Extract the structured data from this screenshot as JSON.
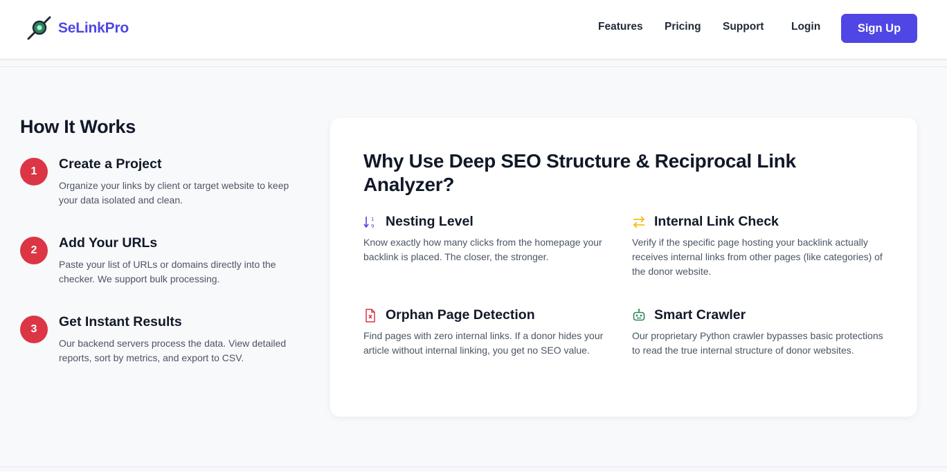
{
  "header": {
    "brand": "SeLinkPro",
    "nav": [
      {
        "label": "Features"
      },
      {
        "label": "Pricing"
      },
      {
        "label": "Support"
      },
      {
        "label": "Login"
      }
    ],
    "signup_label": "Sign Up"
  },
  "how_it_works": {
    "title": "How It Works",
    "steps": [
      {
        "number": "1",
        "title": "Create a Project",
        "description": "Organize your links by client or target website to keep your data isolated and clean."
      },
      {
        "number": "2",
        "title": "Add Your URLs",
        "description": "Paste your list of URLs or domains directly into the checker. We support bulk processing."
      },
      {
        "number": "3",
        "title": "Get Instant Results",
        "description": "Our backend servers process the data. View detailed reports, sort by metrics, and export to CSV."
      }
    ]
  },
  "why": {
    "title": "Why Use Deep SEO Structure & Reciprocal Link Analyzer?",
    "features": [
      {
        "icon": "sort-numeric-icon",
        "title": "Nesting Level",
        "description": "Know exactly how many clicks from the homepage your backlink is placed. The closer, the stronger."
      },
      {
        "icon": "arrows-exchange-icon",
        "title": "Internal Link Check",
        "description": "Verify if the specific page hosting your backlink actually receives internal links from other pages (like categories) of the donor website."
      },
      {
        "icon": "file-x-icon",
        "title": "Orphan Page Detection",
        "description": "Find pages with zero internal links. If a donor hides your article without internal linking, you get no SEO value."
      },
      {
        "icon": "robot-icon",
        "title": "Smart Crawler",
        "description": "Our proprietary Python crawler bypasses basic protections to read the true internal structure of donor websites."
      }
    ]
  },
  "colors": {
    "brand": "#4f46e5",
    "step_badge": "#dc3545",
    "icon_blue": "#4f46e5",
    "icon_yellow": "#f5b800",
    "icon_red": "#dc3545",
    "icon_green": "#2f855a"
  }
}
